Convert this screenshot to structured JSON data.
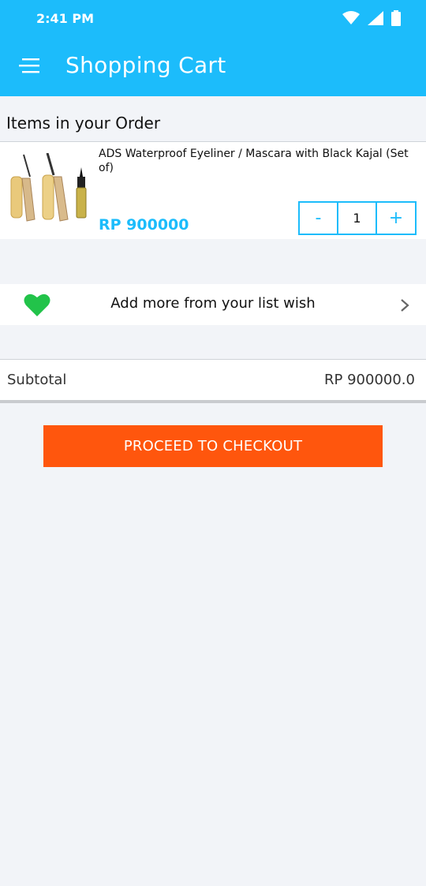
{
  "status_bar": {
    "time": "2:41 PM",
    "icons": [
      "wifi-icon",
      "signal-icon",
      "battery-icon"
    ]
  },
  "app_bar": {
    "title": "Shopping Cart",
    "menu_icon": "menu-icon"
  },
  "order_section": {
    "title": "Items in your Order"
  },
  "cart_items": [
    {
      "name": "ADS Waterproof Eyeliner / Mascara with Black Kajal (Set of)",
      "price": "RP 900000",
      "quantity": "1",
      "minus_label": "-",
      "plus_label": "+"
    }
  ],
  "wishlist": {
    "label": "Add more from your list wish",
    "icon": "heart-icon",
    "chevron": "chevron-right-icon"
  },
  "subtotal": {
    "label": "Subtotal",
    "value": "RP 900000.0"
  },
  "checkout": {
    "label": "PROCEED TO CHECKOUT"
  },
  "colors": {
    "primary": "#1cbcfb",
    "checkout": "#ff560d",
    "heart": "#22c34a",
    "background": "#f2f4f8"
  }
}
